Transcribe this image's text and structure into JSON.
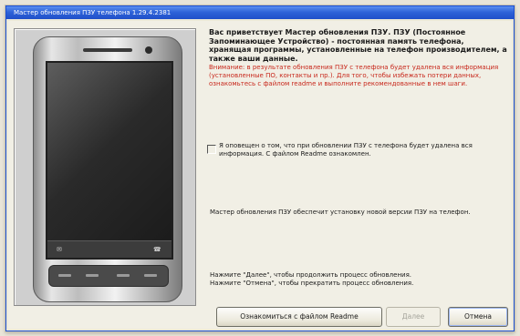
{
  "window": {
    "title": "Мастер обновления ПЗУ телефона 1.29.4.2381"
  },
  "welcome": {
    "heading": "Вас приветствует Мастер обновления ПЗУ. ПЗУ (Постоянное Запоминающее Устройство) - постоянная память телефона, хранящая программы, установленные на телефон производителем, а также ваши данные."
  },
  "warning": {
    "text": "Внимание: в результате обновления ПЗУ с телефона будет удалена вся информация (установленные ПО, контакты и пр.). Для того, чтобы избежать потери данных, ознакомьтесь с файлом readme и выполните рекомендованные в нем шаги."
  },
  "confirm": {
    "label": "Я оповещен о том, что при обновлении ПЗУ с телефона будет удалена вся информация. С файлом Readme ознакомлен.",
    "checked": false
  },
  "info": {
    "text": "Мастер обновления ПЗУ обеспечит установку новой версии ПЗУ на телефон."
  },
  "hint": {
    "line1": "Нажмите \"Далее\", чтобы продолжить процесс обновления.",
    "line2": "Нажмите \"Отмена\", чтобы прекратить процесс обновления."
  },
  "buttons": {
    "readme": "Ознакомиться с файлом Readme",
    "next": "Далее",
    "cancel": "Отмена"
  },
  "device_image": {
    "softkey_left": "✉",
    "softkey_right": "☎"
  },
  "colors": {
    "titlebar": "#2f63d8",
    "warning_text": "#c8281c",
    "background": "#ece9d8"
  }
}
